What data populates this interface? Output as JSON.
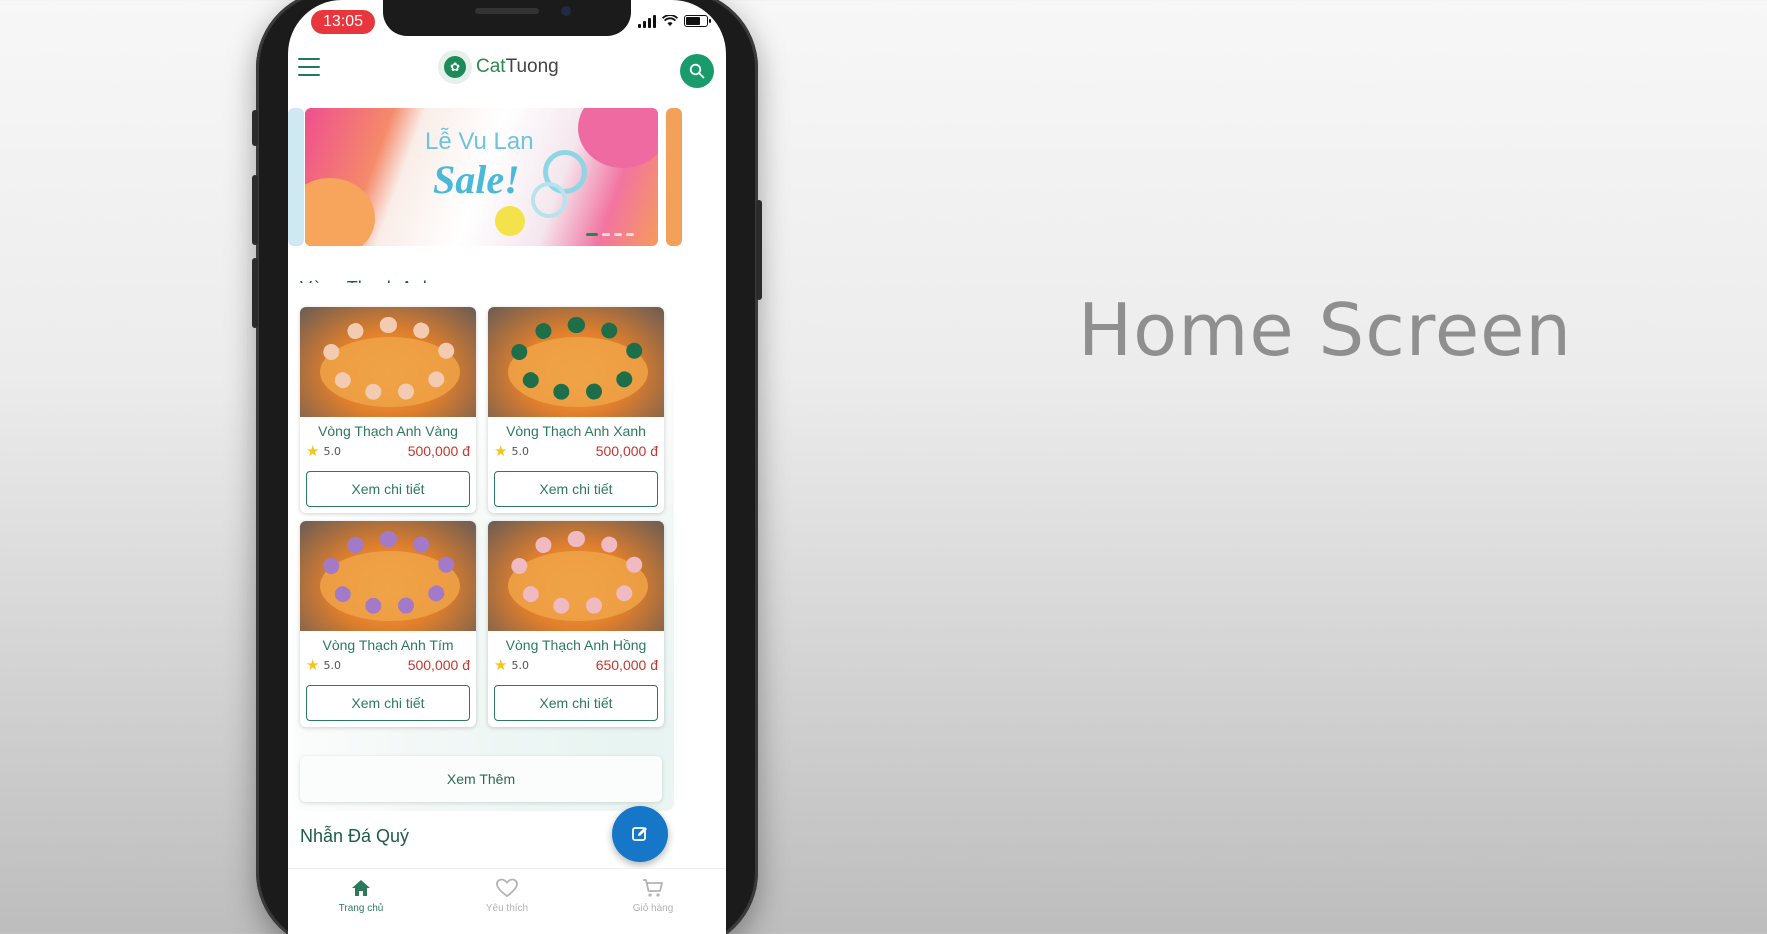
{
  "caption": "Home Screen",
  "status_bar": {
    "time": "13:05"
  },
  "header": {
    "logo_text_a": "Cat",
    "logo_text_b": "Tuong"
  },
  "banner": {
    "line1": "Lễ Vu Lan",
    "line2": "Sale!"
  },
  "section1": {
    "title": "Vòng Thạch Anh",
    "products": [
      {
        "name": "Vòng Thạch Anh Vàng",
        "rating": "5.0",
        "price": "500,000 đ",
        "button": "Xem chi tiết",
        "bead_color": "#f2cbb0"
      },
      {
        "name": "Vòng Thạch Anh Xanh",
        "rating": "5.0",
        "price": "500,000 đ",
        "button": "Xem chi tiết",
        "bead_color": "#1e6e4a"
      },
      {
        "name": "Vòng Thạch Anh Tím",
        "rating": "5.0",
        "price": "500,000 đ",
        "button": "Xem chi tiết",
        "bead_color": "#a27ac8"
      },
      {
        "name": "Vòng Thạch Anh Hồng",
        "rating": "5.0",
        "price": "650,000 đ",
        "button": "Xem chi tiết",
        "bead_color": "#f1b9c1"
      }
    ],
    "more_button": "Xem Thêm"
  },
  "section2": {
    "title": "Nhẫn Đá Quý"
  },
  "bottom_nav": [
    {
      "label": "Trang chủ",
      "icon": "home-icon",
      "active": true
    },
    {
      "label": "Yêu thích",
      "icon": "heart-icon",
      "active": false
    },
    {
      "label": "Giỏ hàng",
      "icon": "cart-icon",
      "active": false
    }
  ],
  "colors": {
    "brand_green": "#1d8a59",
    "price_red": "#c2372f",
    "fab_blue": "#1677c9"
  }
}
